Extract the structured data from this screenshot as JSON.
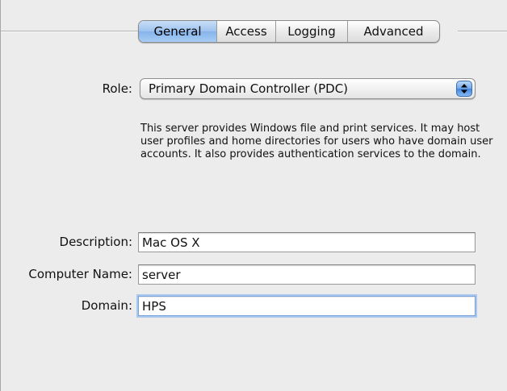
{
  "tabs": [
    {
      "label": "General",
      "selected": true
    },
    {
      "label": "Access",
      "selected": false
    },
    {
      "label": "Logging",
      "selected": false
    },
    {
      "label": "Advanced",
      "selected": false
    }
  ],
  "role": {
    "label": "Role:",
    "value": "Primary Domain Controller (PDC)",
    "description": "This server provides Windows file and print services.  It may host user profiles and home directories for users who have domain user accounts.  It also provides authentication services to the domain."
  },
  "fields": {
    "description": {
      "label": "Description:",
      "value": "Mac OS X"
    },
    "computer_name": {
      "label": "Computer Name:",
      "value": "server"
    },
    "domain": {
      "label": "Domain:",
      "value": "HPS"
    }
  },
  "colors": {
    "selected_tab": "#9dc2ee",
    "popup_arrows": "#3f86e0",
    "focus_ring": "#a9c8f0",
    "background": "#ececec"
  },
  "icons": {
    "popup_arrows": "up-down-arrows-icon"
  }
}
